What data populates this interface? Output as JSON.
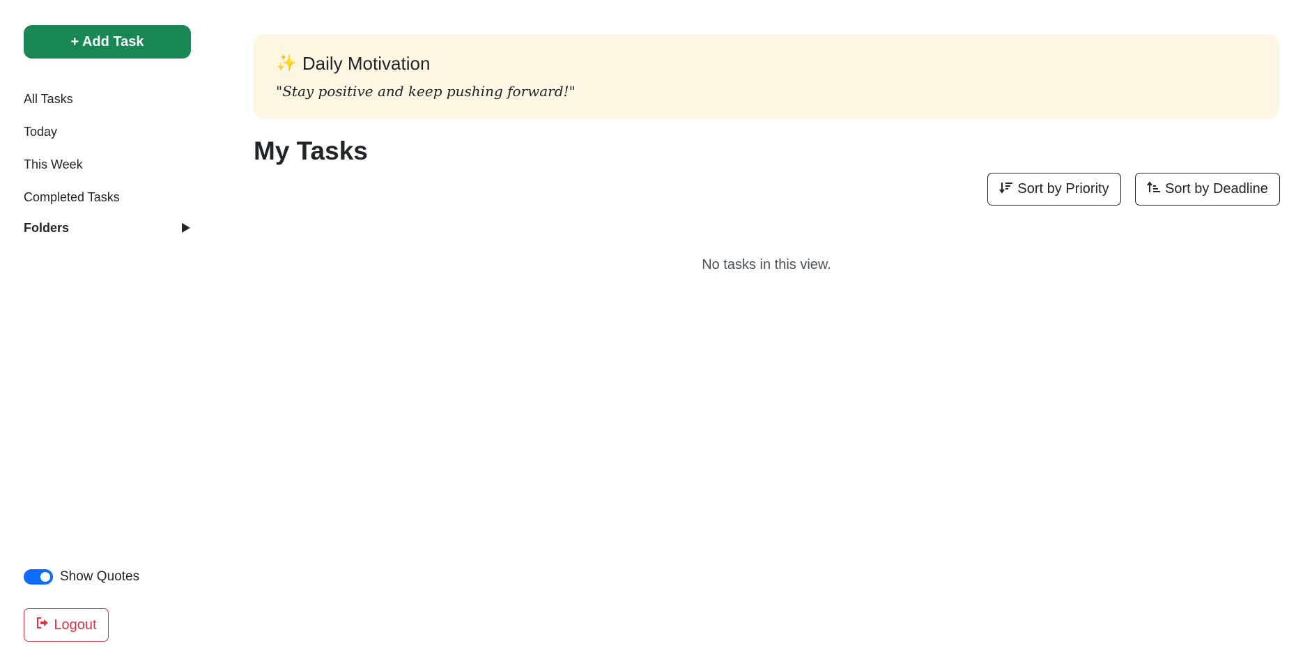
{
  "sidebar": {
    "add_task_label": "+ Add Task",
    "nav_items": [
      {
        "label": "All Tasks"
      },
      {
        "label": "Today"
      },
      {
        "label": "This Week"
      },
      {
        "label": "Completed Tasks"
      }
    ],
    "folders_label": "Folders",
    "folders_icon": "caret-right-icon",
    "show_quotes_label": "Show Quotes",
    "show_quotes_enabled": true,
    "logout_label": "Logout",
    "logout_icon": "sign-out-icon"
  },
  "motivation": {
    "icon": "sparkles-icon",
    "title": "Daily Motivation",
    "quote": "\"Stay positive and keep pushing forward!\""
  },
  "main": {
    "title": "My Tasks",
    "sort_priority_label": "Sort by Priority",
    "sort_priority_icon": "sort-down-icon",
    "sort_deadline_label": "Sort by Deadline",
    "sort_deadline_icon": "sort-up-icon",
    "empty_message": "No tasks in this view."
  },
  "colors": {
    "primary_green": "#198754",
    "toggle_blue": "#0d6efd",
    "logout_red": "#dc3545",
    "motivation_bg": "#fdf6e3",
    "sparkle_gold": "#f5b301"
  }
}
